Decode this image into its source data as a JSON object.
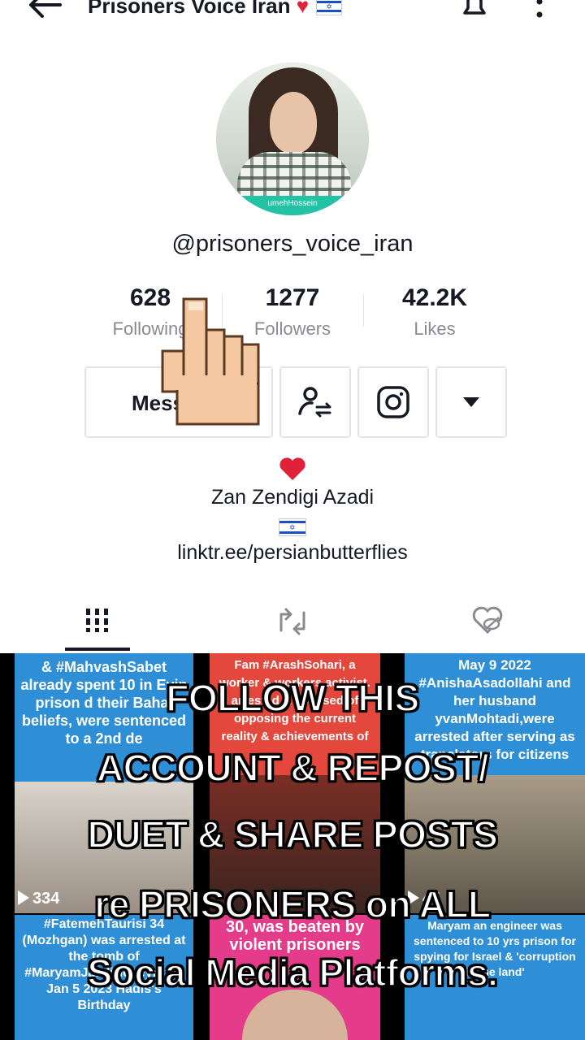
{
  "header": {
    "title": "Prisoners Voice Iran",
    "title_heart": "♥",
    "flag_symbol": "✡"
  },
  "profile": {
    "handle": "@prisoners_voice_iran",
    "avatar_caption": "umehHossein"
  },
  "stats": [
    {
      "count": "628",
      "label": "Following"
    },
    {
      "count": "1277",
      "label": "Followers"
    },
    {
      "count": "42.2K",
      "label": "Likes"
    }
  ],
  "actions": {
    "message_label": "Message"
  },
  "bio": {
    "line1": "Zan Zendigi Azadi",
    "link": "linktr.ee/persianbutterflies"
  },
  "posts": [
    {
      "text": "& #MahvashSabet already spent 10 in Evin prison d their Bahai beliefs, were sentenced to a 2nd de",
      "views": "334"
    },
    {
      "text": "Fam #ArashSohari, a worker & workers activist. arrested & accused of opposing the current reality & achievements of",
      "views": ""
    },
    {
      "text": "May 9 2022 #AnishaAsadollahi and her husband yvanMohtadi,were arrested after serving as translators for citizens",
      "views": "44"
    },
    {
      "text": "#FatemehTaurisi 34 (Mozhgan) was arrested at the tomb of #MaryamJalaliHoseyni on Jan 5 2023 Hadis's Birthday",
      "views": ""
    },
    {
      "text": "30, was beaten by violent prisoners",
      "views": ""
    },
    {
      "text": "Maryam an engineer was sentenced to 10 yrs prison for spying for Israel & 'corruption in the land'",
      "views": ""
    }
  ],
  "overlay": {
    "line1": "FOLLOW THIS",
    "line2": "ACCOUNT & REPOST/",
    "line3": "DUET & SHARE POSTS",
    "line4": "re PRISONERS on ALL",
    "line5": "Social Media Platforms."
  },
  "colors": {
    "accent_teal": "#22c2a4",
    "heart": "#e0213a",
    "post_blue": "#2f8fd6",
    "post_red": "#e4473b",
    "post_pink": "#e43b8a"
  }
}
